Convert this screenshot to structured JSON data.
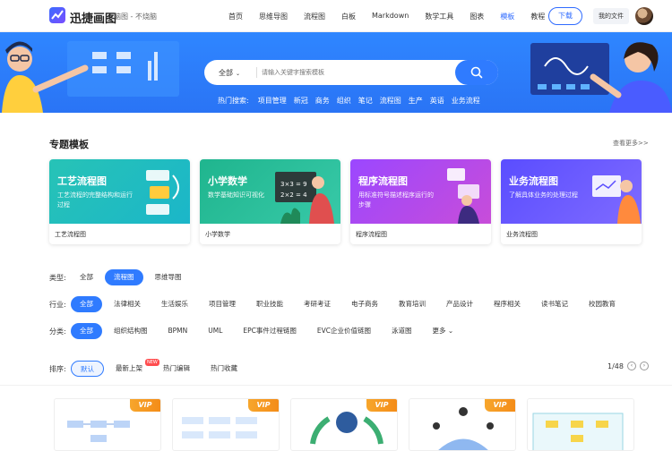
{
  "header": {
    "brand": "迅捷画图",
    "tagline": "脑图 - 不烧脑",
    "nav": [
      "首页",
      "思维导图",
      "流程图",
      "白板",
      "Markdown",
      "数学工具",
      "图表",
      "模板",
      "教程"
    ],
    "active_nav": "模板",
    "download": "下载",
    "my_files": "我的文件"
  },
  "search": {
    "category": "全部",
    "placeholder": "请输入关键字搜索模板",
    "hot_label": "热门搜索:",
    "hot_terms": [
      "项目管理",
      "新冠",
      "商务",
      "组织",
      "笔记",
      "流程图",
      "生产",
      "英语",
      "业务流程"
    ]
  },
  "featured": {
    "title": "专题模板",
    "see_more": "查看更多>>",
    "cards": [
      {
        "title": "工艺流程图",
        "desc": "工艺流程的完整结构和运行过程",
        "footer": "工艺流程图",
        "color_a": "#27c3b6",
        "color_b": "#1bb6c9"
      },
      {
        "title": "小学数学",
        "desc": "数学基础知识可视化",
        "footer": "小学数学",
        "color_a": "#1fb58e",
        "color_b": "#38c9a8"
      },
      {
        "title": "程序流程图",
        "desc": "用标准符号描述程序运行的步骤",
        "footer": "程序流程图",
        "color_a": "#9b47ff",
        "color_b": "#c84dd9"
      },
      {
        "title": "业务流程图",
        "desc": "了解具体业务的处理过程",
        "footer": "业务流程图",
        "color_a": "#5a4dff",
        "color_b": "#7f6bff"
      }
    ]
  },
  "filters": {
    "type_label": "类型:",
    "types": [
      "全部",
      "流程图",
      "思维导图"
    ],
    "type_active": 1,
    "industry_label": "行业:",
    "industries": [
      "全部",
      "法律相关",
      "生活娱乐",
      "项目管理",
      "职业技能",
      "考研考证",
      "电子商务",
      "教育培训",
      "产品设计",
      "程序相关",
      "读书笔记",
      "校园教育"
    ],
    "category_label": "分类:",
    "categories": [
      "全部",
      "组织结构图",
      "BPMN",
      "UML",
      "EPC事件过程链图",
      "EVC企业价值链图",
      "泳道图",
      "更多"
    ],
    "sort_label": "排序:",
    "sorts": [
      "默认",
      "最新上架",
      "热门编辑",
      "热门收藏"
    ],
    "new_badge": "NEW",
    "page": "1/48"
  },
  "thumbs": {
    "vip_label": "VIP"
  },
  "colors": {
    "brand_blue": "#2f7bff",
    "vip_orange": "#f7a62c"
  }
}
